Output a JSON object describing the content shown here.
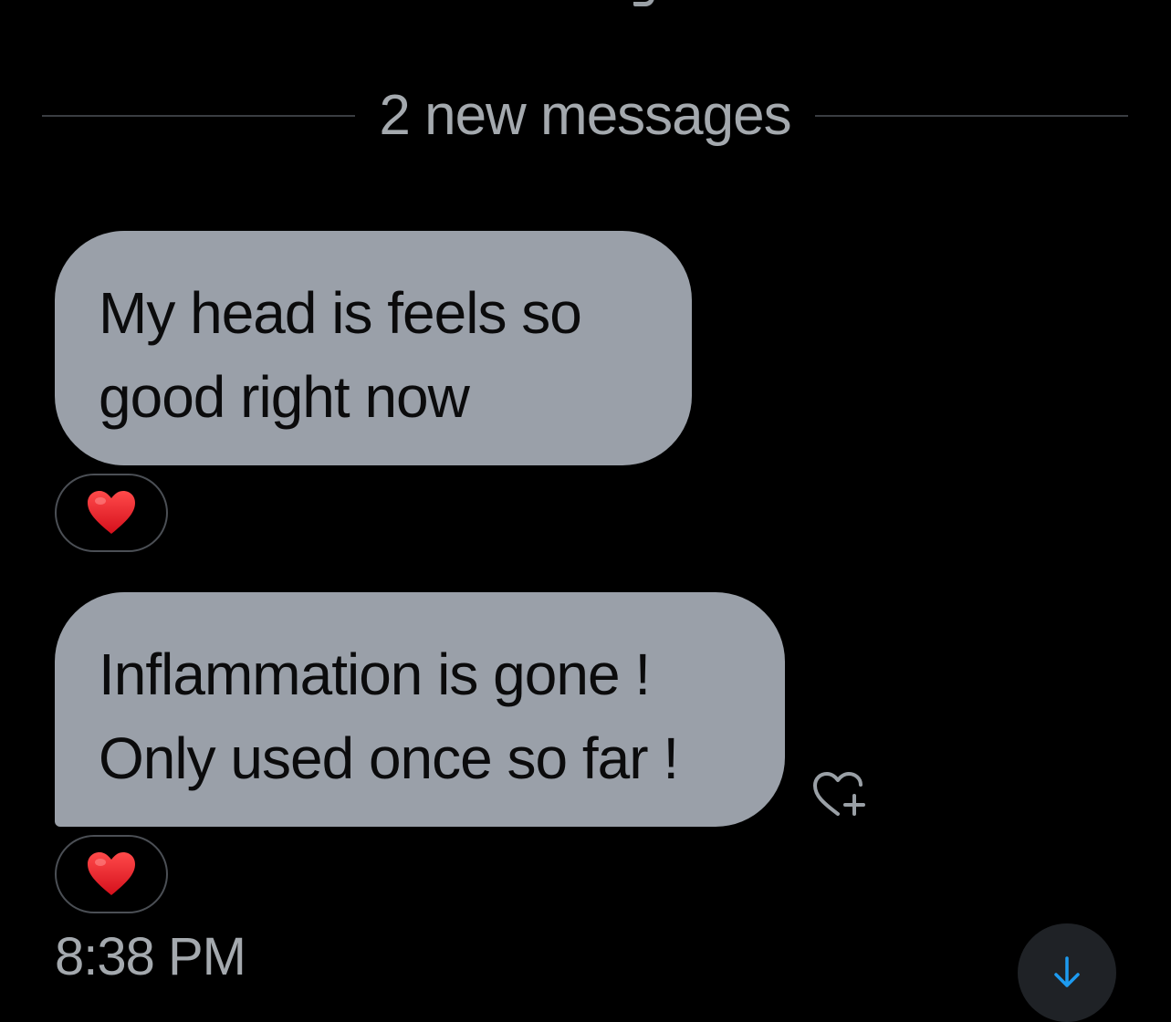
{
  "divider": {
    "label": "2 new messages"
  },
  "messages": [
    {
      "lines": [
        "My head is feels so",
        "good right now"
      ],
      "reaction": "❤️"
    },
    {
      "lines": [
        "Inflammation is gone !",
        "Only used once so far !"
      ],
      "reaction": "❤️"
    }
  ],
  "timestamp": "8:38 PM",
  "icons": {
    "reaction": "heart-emoji",
    "add_reaction": "heart-plus-icon",
    "scroll_down": "arrow-down-icon"
  },
  "colors": {
    "background": "#000000",
    "bubble": "#9aa0a9",
    "muted_text": "#a4a9ae",
    "accent_blue": "#1d9bf0",
    "heart_red": "#e8202a"
  }
}
